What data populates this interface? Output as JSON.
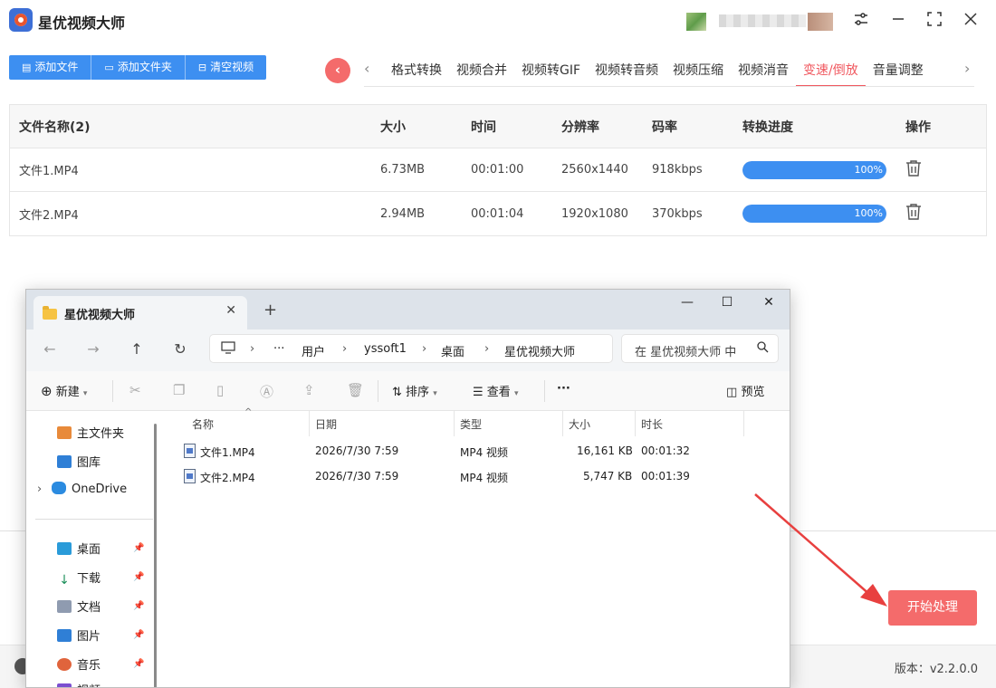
{
  "app": {
    "title": "星优视频大师",
    "version_text": "版本：v2.2.0.0",
    "start_button": "开始处理"
  },
  "toolbar": {
    "buttons": [
      {
        "label": "添加文件",
        "icon": "file-icon"
      },
      {
        "label": "添加文件夹",
        "icon": "folder-icon"
      },
      {
        "label": "清空视频",
        "icon": "trash-icon"
      }
    ]
  },
  "tabs": {
    "items": [
      "格式转换",
      "视频合并",
      "视频转GIF",
      "视频转音频",
      "视频压缩",
      "视频消音",
      "变速/倒放",
      "音量调整"
    ],
    "active": "变速/倒放",
    "active_color": "#f0585f"
  },
  "table": {
    "headers": {
      "name": "文件名称(2)",
      "size": "大小",
      "time": "时间",
      "resolution": "分辨率",
      "bitrate": "码率",
      "progress": "转换进度",
      "action": "操作"
    },
    "rows": [
      {
        "name": "文件1.MP4",
        "size": "6.73MB",
        "time": "00:01:00",
        "resolution": "2560x1440",
        "bitrate": "918kbps",
        "progress_text": "100%",
        "progress": 1.0
      },
      {
        "name": "文件2.MP4",
        "size": "2.94MB",
        "time": "00:01:04",
        "resolution": "1920x1080",
        "bitrate": "370kbps",
        "progress_text": "100%",
        "progress": 1.0
      }
    ]
  },
  "explorer": {
    "tab_title": "星优视频大师",
    "address": {
      "ellipsis": "···",
      "segments": [
        "用户",
        "yssoft1",
        "桌面",
        "星优视频大师"
      ]
    },
    "search_placeholder": "在 星优视频大师 中",
    "commands": {
      "new": "新建",
      "sort": "排序",
      "view": "查看",
      "more": "···",
      "preview": "预览"
    },
    "sidebar": {
      "top": [
        {
          "label": "主文件夹",
          "icon": "home-icon"
        },
        {
          "label": "图库",
          "icon": "gallery-icon"
        },
        {
          "label": "OneDrive",
          "icon": "cloud-icon"
        }
      ],
      "pinned": [
        {
          "label": "桌面",
          "icon": "desktop-icon"
        },
        {
          "label": "下载",
          "icon": "download-icon"
        },
        {
          "label": "文档",
          "icon": "document-icon"
        },
        {
          "label": "图片",
          "icon": "picture-icon"
        },
        {
          "label": "音乐",
          "icon": "music-icon"
        },
        {
          "label": "视频",
          "icon": "video-icon"
        }
      ]
    },
    "columns": {
      "name": "名称",
      "date": "日期",
      "type": "类型",
      "size": "大小",
      "duration": "时长"
    },
    "files": [
      {
        "name": "文件1.MP4",
        "date": "2026/7/30 7:59",
        "type": "MP4 视频",
        "size": "16,161 KB",
        "duration": "00:01:32"
      },
      {
        "name": "文件2.MP4",
        "date": "2026/7/30 7:59",
        "type": "MP4 视频",
        "size": "5,747 KB",
        "duration": "00:01:39"
      }
    ]
  },
  "colors": {
    "primary_blue": "#3d8ff1",
    "accent_red": "#f46b6b"
  }
}
